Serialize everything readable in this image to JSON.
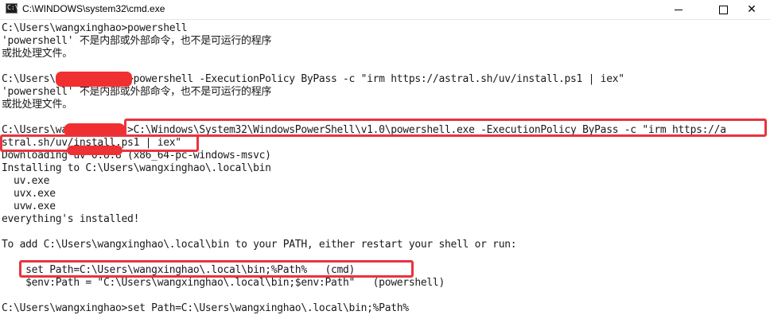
{
  "window": {
    "title": "C:\\WINDOWS\\system32\\cmd.exe",
    "icon_label": "C:\\",
    "controls": {
      "minimize": "minimize-icon",
      "maximize": "maximize-icon",
      "close": "✕"
    }
  },
  "console": {
    "lines": [
      "C:\\Users\\wangxinghao>powershell",
      "'powershell' 不是内部或外部命令，也不是可运行的程序",
      "或批处理文件。",
      "",
      "C:\\Users\\            >powershell -ExecutionPolicy ByPass -c \"irm https://astral.sh/uv/install.ps1 | iex\"",
      "'powershell' 不是内部或外部命令，也不是可运行的程序",
      "或批处理文件。",
      "",
      "C:\\Users\\wa          >C:\\Windows\\System32\\WindowsPowerShell\\v1.0\\powershell.exe -ExecutionPolicy ByPass -c \"irm https://a",
      "stral.sh/uv/install.ps1 | iex\"",
      "Downloading uv 0.8.8 (x86_64-pc-windows-msvc)",
      "Installing to C:\\Users\\wangxinghao\\.local\\bin",
      "  uv.exe",
      "  uvx.exe",
      "  uvw.exe",
      "everything's installed!",
      "",
      "To add C:\\Users\\wangxinghao\\.local\\bin to your PATH, either restart your shell or run:",
      "",
      "    set Path=C:\\Users\\wangxinghao\\.local\\bin;%Path%   (cmd)",
      "    $env:Path = \"C:\\Users\\wangxinghao\\.local\\bin;$env:Path\"   (powershell)",
      "",
      "C:\\Users\\wangxinghao>set Path=C:\\Users\\wangxinghao\\.local\\bin;%Path%"
    ]
  },
  "colors": {
    "console_bg": "#ffffff",
    "console_text": "#1a1a1a",
    "annotation_red": "#e8343f",
    "redaction_red": "#f03030"
  }
}
